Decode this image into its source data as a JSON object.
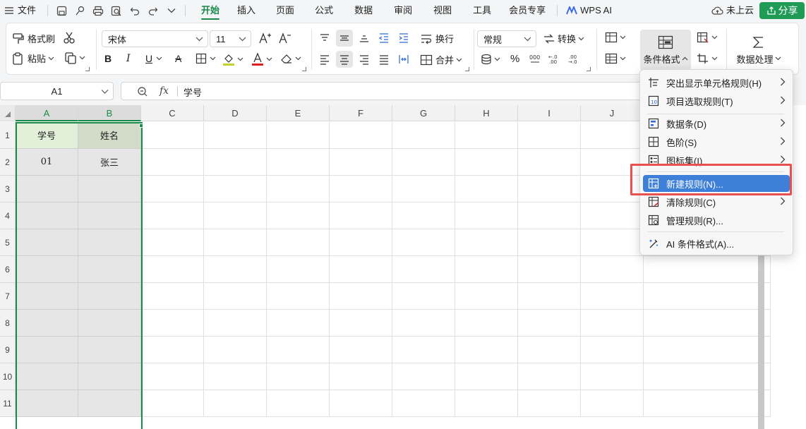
{
  "menubar": {
    "file_label": "文件",
    "tabs": [
      "开始",
      "插入",
      "页面",
      "公式",
      "数据",
      "审阅",
      "视图",
      "工具",
      "会员专享"
    ],
    "ai_label": "WPS AI",
    "cloud_label": "未上云",
    "share_label": "分享"
  },
  "ribbon": {
    "format_painter": "格式刷",
    "paste": "粘贴",
    "font_name": "宋体",
    "font_size": "11",
    "wrap": "换行",
    "number_format": "常规",
    "convert": "转换",
    "merge": "合并",
    "percent": "%",
    "cond_format": "条件格式",
    "data_process": "数据处理"
  },
  "formula": {
    "name_box": "A1",
    "fx_label": "fx",
    "content": "学号"
  },
  "sheet": {
    "columns": [
      "A",
      "B",
      "C",
      "D",
      "E",
      "F",
      "G",
      "H",
      "I",
      "J"
    ],
    "rows": [
      "1",
      "2",
      "3",
      "4",
      "5",
      "6",
      "7",
      "8",
      "9",
      "10",
      "11"
    ],
    "cells": {
      "A1": "学号",
      "B1": "姓名",
      "A2": "01",
      "B2": "张三"
    }
  },
  "cond_menu": {
    "items": [
      "突出显示单元格规则(H)",
      "项目选取规则(T)",
      "数据条(D)",
      "色阶(S)",
      "图标集(I)",
      "新建规则(N)...",
      "清除规则(C)",
      "管理规则(R)...",
      "AI 条件格式(A)..."
    ]
  },
  "colors": {
    "accent": "#1a8a4a",
    "highlight": "#3d7fd9",
    "callout": "#e8504f",
    "header_fill": "#e2efd9"
  }
}
